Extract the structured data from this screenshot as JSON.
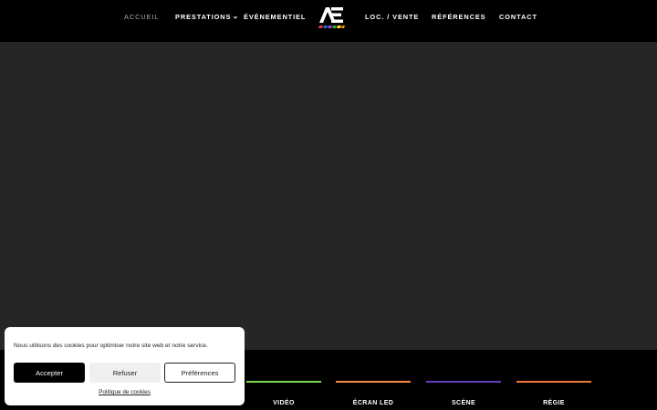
{
  "nav": {
    "items": [
      {
        "label": "ACCUEIL"
      },
      {
        "label": "PRESTATIONS"
      },
      {
        "label": "ÉVÉNEMENTIEL"
      },
      {
        "label": "LOC. / VENTE"
      },
      {
        "label": "RÉFÉRENCES"
      },
      {
        "label": "CONTACT"
      }
    ],
    "logo_text": "AE"
  },
  "services": [
    {
      "label": "VIDÉO",
      "color": "#7ed957"
    },
    {
      "label": "ÉCRAN LED",
      "color": "#f28c44"
    },
    {
      "label": "SCÈNE",
      "color": "#6a3cc2"
    },
    {
      "label": "RÉGIE",
      "color": "#f07a3c"
    }
  ],
  "cookie": {
    "message": "Nous utilisons des cookies pour optimiser notre site web et notre service.",
    "accept_label": "Accepter",
    "refuse_label": "Refuser",
    "prefs_label": "Préférences",
    "policy_link": "Politique de cookies"
  },
  "colors": {
    "header_bg": "#000000",
    "hero_bg": "#262626"
  }
}
